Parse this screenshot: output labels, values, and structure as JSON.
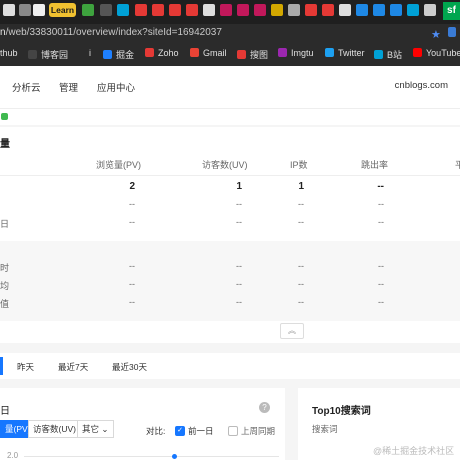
{
  "browser": {
    "learn_tab": "Learn",
    "sf_tab": "sf",
    "url_host": "n",
    "url_path": "/web/33830011/overview/index?siteId=16942037"
  },
  "bookmarks": [
    "thub",
    "博客园",
    "i",
    "掘金",
    "Zoho",
    "Gmail",
    "搜图",
    "Imgtu",
    "Twitter",
    "B站",
    "YouTube"
  ],
  "header": {
    "nav": [
      "分析云",
      "管理",
      "应用中心"
    ],
    "site": "cnblogs.com"
  },
  "overview": {
    "title": "量",
    "columns": [
      "浏览量(PV)",
      "访客数(UV)",
      "IP数",
      "跳出率",
      "平"
    ],
    "rows": [
      {
        "label": "",
        "pv": "2",
        "uv": "1",
        "ip": "1",
        "bounce": "--"
      },
      {
        "label": "",
        "pv": "--",
        "uv": "--",
        "ip": "--",
        "bounce": "--"
      },
      {
        "label": "日",
        "pv": "--",
        "uv": "--",
        "ip": "--",
        "bounce": "--"
      }
    ],
    "stats": [
      {
        "label": "时",
        "pv": "--",
        "uv": "--",
        "ip": "--",
        "bounce": "--"
      },
      {
        "label": "均",
        "pv": "--",
        "uv": "--",
        "ip": "--",
        "bounce": "--"
      },
      {
        "label": "值",
        "pv": "--",
        "uv": "--",
        "ip": "--",
        "bounce": "--"
      }
    ]
  },
  "date_tabs": [
    "昨天",
    "最近7天",
    "最近30天"
  ],
  "trend": {
    "title": "日",
    "metric_active": "量(PV)",
    "metric_uv": "访客数(UV)",
    "metric_other": "其它",
    "compare_label": "对比:",
    "prev_day": "前一日",
    "last_week": "上周同期",
    "y_tick": "2.0"
  },
  "top10": {
    "title": "Top10搜索词",
    "col": "搜索词"
  },
  "watermark": "@稀土掘金技术社区",
  "colors": {
    "accent": "#1677ff",
    "green": "#3fb950"
  }
}
